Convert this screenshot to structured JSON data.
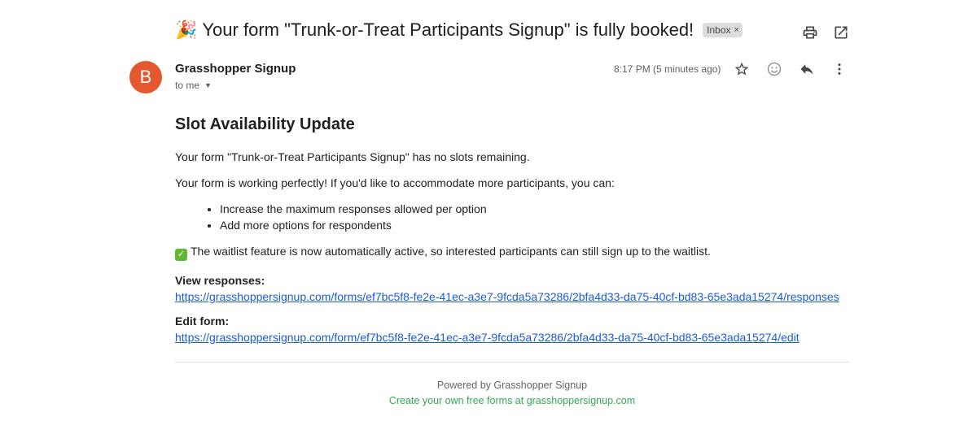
{
  "email": {
    "subject_emoji": "🎉",
    "subject": "Your form \"Trunk-or-Treat Participants Signup\" is fully booked!",
    "label_badge": "Inbox",
    "label_badge_close": "×",
    "sender_initial": "B",
    "sender_name": "Grasshopper Signup",
    "recipient": "to me",
    "timestamp": "8:17 PM (5 minutes ago)"
  },
  "body": {
    "heading": "Slot Availability Update",
    "no_slots": "Your form \"Trunk-or-Treat Participants Signup\" has no slots remaining.",
    "intro": "Your form is working perfectly! If you'd like to accommodate more participants, you can:",
    "options": [
      "Increase the maximum responses allowed per option",
      "Add more options for respondents"
    ],
    "waitlist": "The waitlist feature is now automatically active, so interested participants can still sign up to the waitlist.",
    "view_label": "View responses:",
    "view_url": "https://grasshoppersignup.com/forms/ef7bc5f8-fe2e-41ec-a3e7-9fcda5a73286/2bfa4d33-da75-40cf-bd83-65e3ada15274/responses",
    "edit_label": "Edit form:",
    "edit_url": "https://grasshoppersignup.com/form/ef7bc5f8-fe2e-41ec-a3e7-9fcda5a73286/2bfa4d33-da75-40cf-bd83-65e3ada15274/edit"
  },
  "footer": {
    "powered": "Powered by Grasshopper Signup",
    "cta": "Create your own free forms at grasshoppersignup.com"
  },
  "icons": {
    "top": [
      "print-icon",
      "open-in-new-window-icon"
    ],
    "message": [
      "star-icon",
      "emoji-reaction-icon",
      "reply-icon",
      "more-options-icon"
    ]
  },
  "colors": {
    "avatar": "#e4582e",
    "link": "#1a5bd6",
    "footer_cta": "#34a853",
    "checkmark": "#5fb832"
  }
}
